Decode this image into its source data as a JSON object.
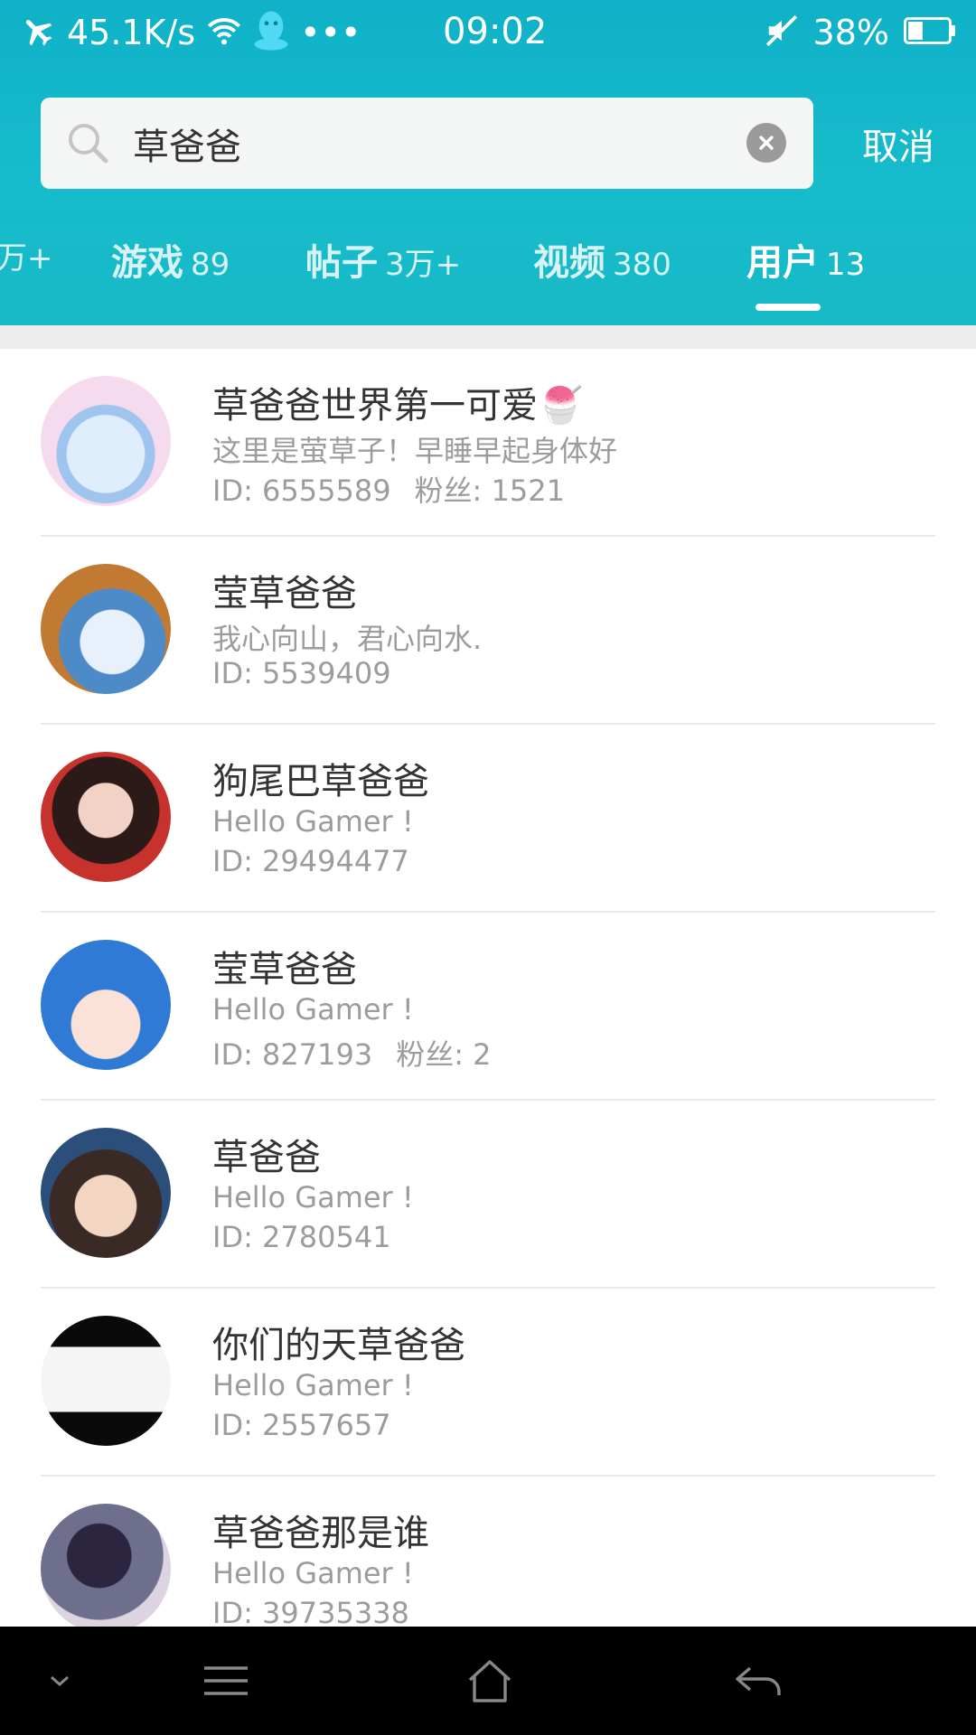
{
  "status_bar": {
    "network_speed": "45.1K/s",
    "more": "•••",
    "time": "09:02",
    "battery": "38%",
    "battery_level": 0.38
  },
  "search": {
    "query": "草爸爸",
    "cancel_label": "取消"
  },
  "tabs": [
    {
      "label": "",
      "count": "万+"
    },
    {
      "label": "游戏",
      "count": "89"
    },
    {
      "label": "帖子",
      "count": "3万+"
    },
    {
      "label": "视频",
      "count": "380"
    },
    {
      "label": "用户",
      "count": "13"
    }
  ],
  "active_tab": "用户",
  "users": [
    {
      "name": "草爸爸世界第一可爱🍧",
      "bio": "这里是萤草子！早睡早起身体好",
      "id": "ID: 6555589",
      "fans": "粉丝: 1521"
    },
    {
      "name": "莹草爸爸",
      "bio": "我心向山，君心向水.",
      "id": "ID: 5539409",
      "fans": ""
    },
    {
      "name": "狗尾巴草爸爸",
      "bio": "Hello Gamer !",
      "id": "ID: 29494477",
      "fans": ""
    },
    {
      "name": "莹草爸爸",
      "bio": "Hello Gamer !",
      "id": "ID: 827193",
      "fans": "粉丝: 2"
    },
    {
      "name": "草爸爸",
      "bio": "Hello Gamer !",
      "id": "ID: 2780541",
      "fans": ""
    },
    {
      "name": "你们的天草爸爸",
      "bio": "Hello Gamer !",
      "id": "ID: 2557657",
      "fans": ""
    },
    {
      "name": "草爸爸那是谁",
      "bio": "Hello Gamer !",
      "id": "ID: 39735338",
      "fans": ""
    }
  ],
  "colors": {
    "header": "#16bccb",
    "nav_bar": "#000000",
    "divider": "#e9e9e9"
  },
  "icons": {
    "status": [
      "airplane-icon",
      "wifi-icon",
      "qq-icon",
      "mute-icon",
      "battery-icon"
    ],
    "nav": [
      "chevron-down-icon",
      "menu-icon",
      "home-icon",
      "back-icon"
    ]
  }
}
